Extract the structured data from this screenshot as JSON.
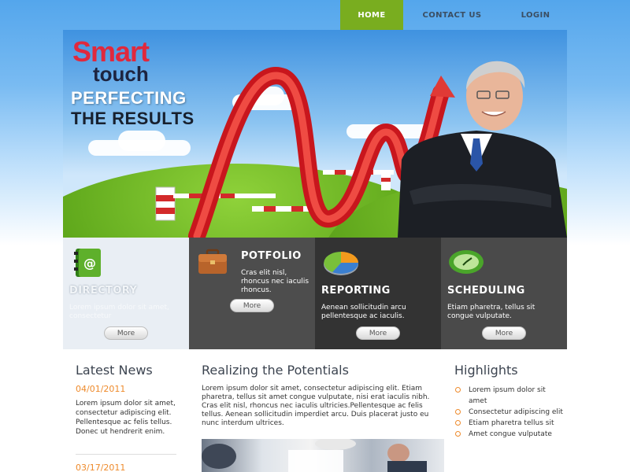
{
  "nav": {
    "home": "HOME",
    "contact": "CONTACT US",
    "login": "LOGIN",
    "active_color": "#79ad1f"
  },
  "hero": {
    "logo_top": "Smart",
    "logo_bottom": "touch",
    "headline_line1": "PERFECTING",
    "headline_line2": "THE RESULTS"
  },
  "features": [
    {
      "title": "DIRECTORY",
      "text": "Lorem ipsum dolor sit amet, consectetur",
      "more": "More",
      "icon": "address-book-icon"
    },
    {
      "title": "POTFOLIO",
      "text": "Cras elit nisl, rhoncus nec iaculis rhoncus.",
      "more": "More",
      "icon": "briefcase-icon"
    },
    {
      "title": "REPORTING",
      "text": "Aenean sollicitudin arcu pellentesque ac iaculis.",
      "more": "More",
      "icon": "pie-chart-icon"
    },
    {
      "title": "SCHEDULING",
      "text": "Etiam pharetra, tellus sit congue vulputate.",
      "more": "More",
      "icon": "clock-icon"
    }
  ],
  "news": {
    "title": "Latest News",
    "items": [
      {
        "date": "04/01/2011",
        "text": "Lorem ipsum dolor sit amet, consectetur adipiscing elit. Pellentesque ac felis tellus. Donec ut hendrerit enim."
      },
      {
        "date": "03/17/2011",
        "text": ""
      }
    ]
  },
  "main": {
    "title": "Realizing the Potentials",
    "text": "Lorem ipsum dolor sit amet, consectetur adipiscing elit. Etiam pharetra, tellus sit amet congue vulputate, nisi erat iaculis nibh. Cras elit nisl, rhoncus nec iaculis ultricies.Pellentesque ac felis tellus. Aenean sollicitudin imperdiet arcu. Duis placerat justo eu nunc interdum ultrices."
  },
  "highlights": {
    "title": "Highlights",
    "items": [
      "Lorem ipsum dolor sit amet",
      "Consectetur adipiscing elit",
      "Etiam pharetra tellus sit",
      "Amet congue vulputate"
    ]
  },
  "colors": {
    "accent_orange": "#ee8a2b",
    "accent_green": "#79ad1f",
    "logo_red": "#e0293d"
  }
}
